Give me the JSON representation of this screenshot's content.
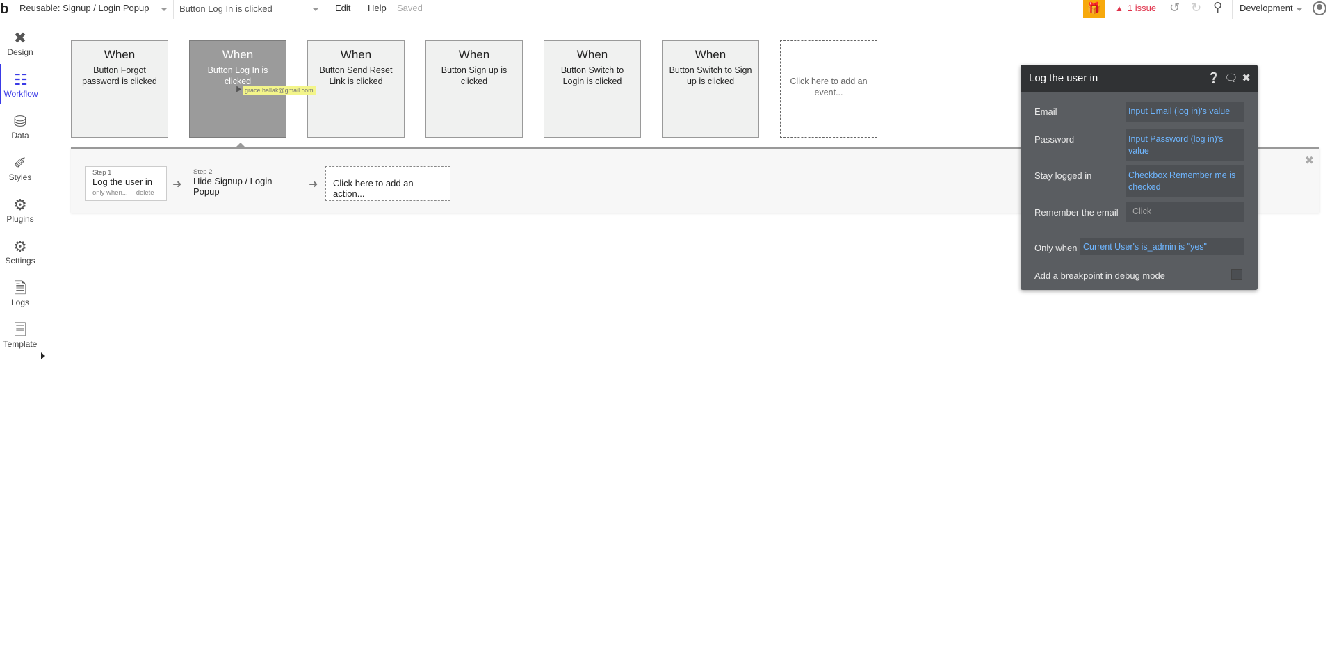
{
  "topbar": {
    "logo": "b",
    "page": "Reusable: Signup / Login Popup",
    "workflow": "Button Log In is clicked",
    "edit": "Edit",
    "help": "Help",
    "saved": "Saved",
    "issues": "1 issue",
    "environment": "Development",
    "accent_color": "#f7a90c",
    "issue_color": "#e0324b"
  },
  "sidebar": {
    "items": [
      {
        "label": "Design",
        "icon": "design-icon"
      },
      {
        "label": "Workflow",
        "icon": "workflow-icon"
      },
      {
        "label": "Data",
        "icon": "database-icon"
      },
      {
        "label": "Styles",
        "icon": "brush-icon"
      },
      {
        "label": "Plugins",
        "icon": "plug-icon"
      },
      {
        "label": "Settings",
        "icon": "gear-icon"
      },
      {
        "label": "Logs",
        "icon": "document-icon"
      },
      {
        "label": "Template",
        "icon": "template-icon"
      }
    ],
    "active": "Workflow"
  },
  "events": [
    {
      "when": "When",
      "label": "Button Forgot password is clicked"
    },
    {
      "when": "When",
      "label": "Button Log In is clicked"
    },
    {
      "when": "When",
      "label": "Button Send Reset Link is clicked"
    },
    {
      "when": "When",
      "label": "Button Sign up is clicked"
    },
    {
      "when": "When",
      "label": "Button Switch to Login is clicked"
    },
    {
      "when": "When",
      "label": "Button Switch to Sign up is clicked"
    }
  ],
  "add_event": "Click here to add an event...",
  "tooltip": "grace.hallak@gmail.com",
  "steps": [
    {
      "num": "Step 1",
      "name": "Log the user in",
      "only_when": "only when...",
      "delete": "delete"
    },
    {
      "num": "Step 2",
      "name": "Hide Signup / Login Popup"
    }
  ],
  "add_action": "Click here to add an action...",
  "panel": {
    "title": "Log the user in",
    "email_label": "Email",
    "email_value": "Input Email (log in)'s value",
    "password_label": "Password",
    "password_value": "Input Password (log in)'s value",
    "stay_label": "Stay logged in",
    "stay_value": "Checkbox Remember me is checked",
    "remember_label": "Remember the email",
    "remember_value": "Click",
    "only_when_label": "Only when",
    "only_when_value": "Current User's is_admin is \"yes\"",
    "breakpoint_label": "Add a breakpoint in debug mode"
  }
}
